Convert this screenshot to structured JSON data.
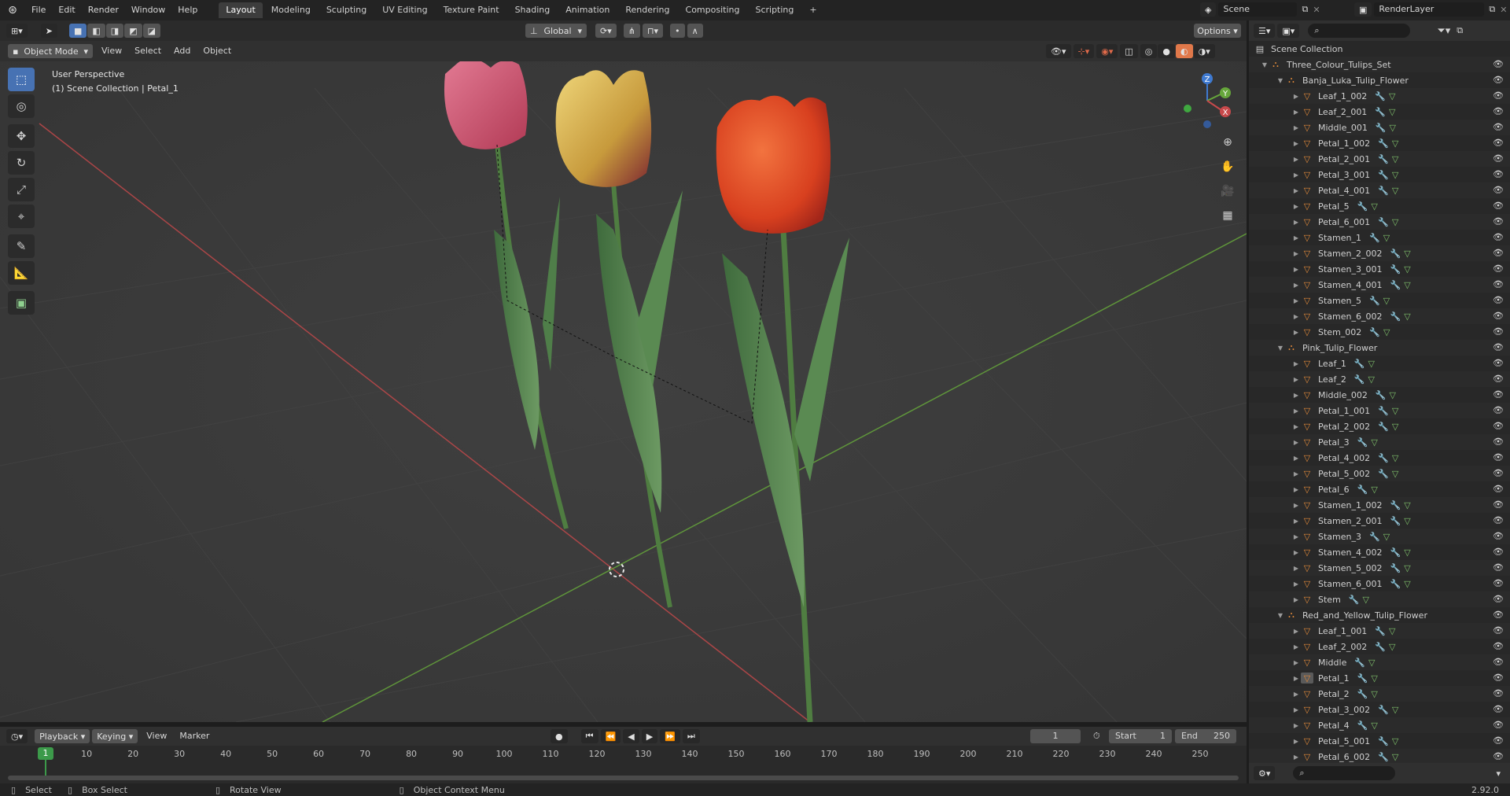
{
  "menu": {
    "items": [
      "File",
      "Edit",
      "Render",
      "Window",
      "Help"
    ]
  },
  "workspaces": {
    "tabs": [
      "Layout",
      "Modeling",
      "Sculpting",
      "UV Editing",
      "Texture Paint",
      "Shading",
      "Animation",
      "Rendering",
      "Compositing",
      "Scripting"
    ],
    "active": "Layout",
    "add": "+"
  },
  "scene": {
    "label": "Scene",
    "render_layer": "RenderLayer"
  },
  "header": {
    "mode": "Object Mode",
    "view": "View",
    "select": "Select",
    "add": "Add",
    "object": "Object",
    "transform": "Global",
    "options": "Options"
  },
  "viewport": {
    "perspective": "User Perspective",
    "collection": "(1) Scene Collection | Petal_1"
  },
  "gizmo": {
    "z": "Z",
    "y": "Y",
    "x": "X"
  },
  "outliner": {
    "root": "Scene Collection",
    "collection": "Three_Colour_Tulips_Set",
    "groups": [
      {
        "name": "Banja_Luka_Tulip_Flower",
        "items": [
          "Leaf_1_002",
          "Leaf_2_001",
          "Middle_001",
          "Petal_1_002",
          "Petal_2_001",
          "Petal_3_001",
          "Petal_4_001",
          "Petal_5",
          "Petal_6_001",
          "Stamen_1",
          "Stamen_2_002",
          "Stamen_3_001",
          "Stamen_4_001",
          "Stamen_5",
          "Stamen_6_002",
          "Stem_002"
        ]
      },
      {
        "name": "Pink_Tulip_Flower",
        "items": [
          "Leaf_1",
          "Leaf_2",
          "Middle_002",
          "Petal_1_001",
          "Petal_2_002",
          "Petal_3",
          "Petal_4_002",
          "Petal_5_002",
          "Petal_6",
          "Stamen_1_002",
          "Stamen_2_001",
          "Stamen_3",
          "Stamen_4_002",
          "Stamen_5_002",
          "Stamen_6_001",
          "Stem"
        ]
      },
      {
        "name": "Red_and_Yellow_Tulip_Flower",
        "items": [
          "Leaf_1_001",
          "Leaf_2_002",
          "Middle",
          "Petal_1",
          "Petal_2",
          "Petal_3_002",
          "Petal_4",
          "Petal_5_001",
          "Petal_6_002"
        ]
      }
    ]
  },
  "timeline": {
    "playback": "Playback",
    "keying": "Keying",
    "view": "View",
    "marker": "Marker",
    "current_frame": "1",
    "start_label": "Start",
    "start": "1",
    "end_label": "End",
    "end": "250",
    "ticks": [
      "1",
      "10",
      "20",
      "30",
      "40",
      "50",
      "60",
      "70",
      "80",
      "90",
      "100",
      "110",
      "120",
      "130",
      "140",
      "150",
      "160",
      "170",
      "180",
      "190",
      "200",
      "210",
      "220",
      "230",
      "240",
      "250"
    ]
  },
  "status": {
    "select": "Select",
    "box_select": "Box Select",
    "rotate_view": "Rotate View",
    "context_menu": "Object Context Menu",
    "version": "2.92.0"
  },
  "colors": {
    "accent": "#4772b3",
    "x_axis": "#c8494b",
    "y_axis": "#66a63b",
    "z_axis": "#3f7ad1",
    "object_icon": "#e28a3a"
  }
}
